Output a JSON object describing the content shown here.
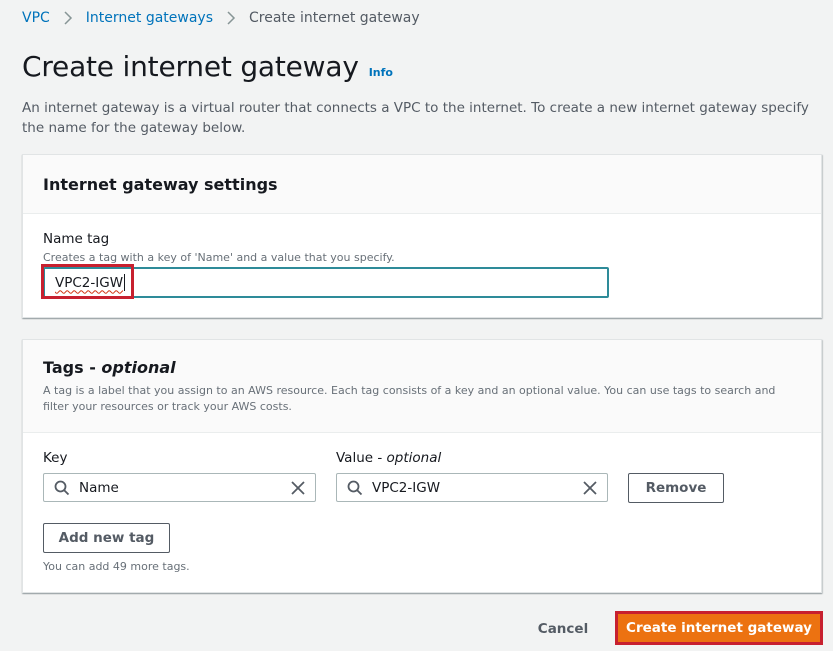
{
  "breadcrumb": {
    "items": [
      {
        "label": "VPC",
        "link": true
      },
      {
        "label": "Internet gateways",
        "link": true
      },
      {
        "label": "Create internet gateway",
        "link": false
      }
    ]
  },
  "header": {
    "title": "Create internet gateway",
    "info_label": "Info",
    "description": "An internet gateway is a virtual router that connects a VPC to the internet. To create a new internet gateway specify the name for the gateway below."
  },
  "settings": {
    "title": "Internet gateway settings",
    "name_tag": {
      "label": "Name tag",
      "description": "Creates a tag with a key of 'Name' and a value that you specify.",
      "value": "VPC2-IGW"
    }
  },
  "tags": {
    "title": "Tags - ",
    "title_optional": "optional",
    "description": "A tag is a label that you assign to an AWS resource. Each tag consists of a key and an optional value. You can use tags to search and filter your resources or track your AWS costs.",
    "key_label": "Key",
    "value_label": "Value - ",
    "value_label_optional": "optional",
    "rows": [
      {
        "key": "Name",
        "value": "VPC2-IGW"
      }
    ],
    "remove_label": "Remove",
    "add_label": "Add new tag",
    "limit_text": "You can add 49 more tags."
  },
  "footer": {
    "cancel_label": "Cancel",
    "create_label": "Create internet gateway"
  },
  "colors": {
    "link": "#0073bb",
    "primary": "#ec7211",
    "focus": "#2e8b99",
    "highlight": "#c7202f"
  }
}
